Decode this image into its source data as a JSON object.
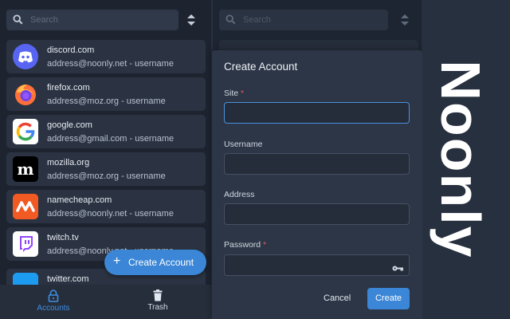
{
  "search": {
    "placeholder": "Search"
  },
  "accounts": [
    {
      "site": "discord.com",
      "subtitle": "address@noonly.net - username",
      "logo": "discord-logo",
      "color": "#5865f2"
    },
    {
      "site": "firefox.com",
      "subtitle": "address@moz.org - username",
      "logo": "firefox-logo",
      "color": "#ff7139"
    },
    {
      "site": "google.com",
      "subtitle": "address@gmail.com - username",
      "logo": "google-logo",
      "color": "#ffffff"
    },
    {
      "site": "mozilla.org",
      "subtitle": "address@moz.org - username",
      "logo": "mozilla-logo",
      "color": "#000000"
    },
    {
      "site": "namecheap.com",
      "subtitle": "address@noonly.net - username",
      "logo": "namecheap-logo",
      "color": "#f15a22"
    },
    {
      "site": "twitch.tv",
      "subtitle": "address@noonly.net - username",
      "logo": "twitch-logo",
      "color": "#9146ff"
    },
    {
      "site": "twitter.com",
      "subtitle": "",
      "logo": "twitter-logo",
      "color": "#1d9bf0"
    }
  ],
  "fab": {
    "label": "Create Account",
    "icon": "plus-icon"
  },
  "nav": {
    "accounts": "Accounts",
    "trash": "Trash"
  },
  "dialog": {
    "title": "Create Account",
    "fields": {
      "site": {
        "label": "Site",
        "required": "*",
        "value": ""
      },
      "username": {
        "label": "Username",
        "value": ""
      },
      "address": {
        "label": "Address",
        "value": ""
      },
      "password": {
        "label": "Password",
        "required": "*",
        "value": ""
      }
    },
    "cancel": "Cancel",
    "create": "Create"
  },
  "brand": {
    "name": "Noonly"
  },
  "colors": {
    "accent": "#3b86d6",
    "background": "#27303f",
    "panel": "#1d2430",
    "card": "#2b3342"
  }
}
